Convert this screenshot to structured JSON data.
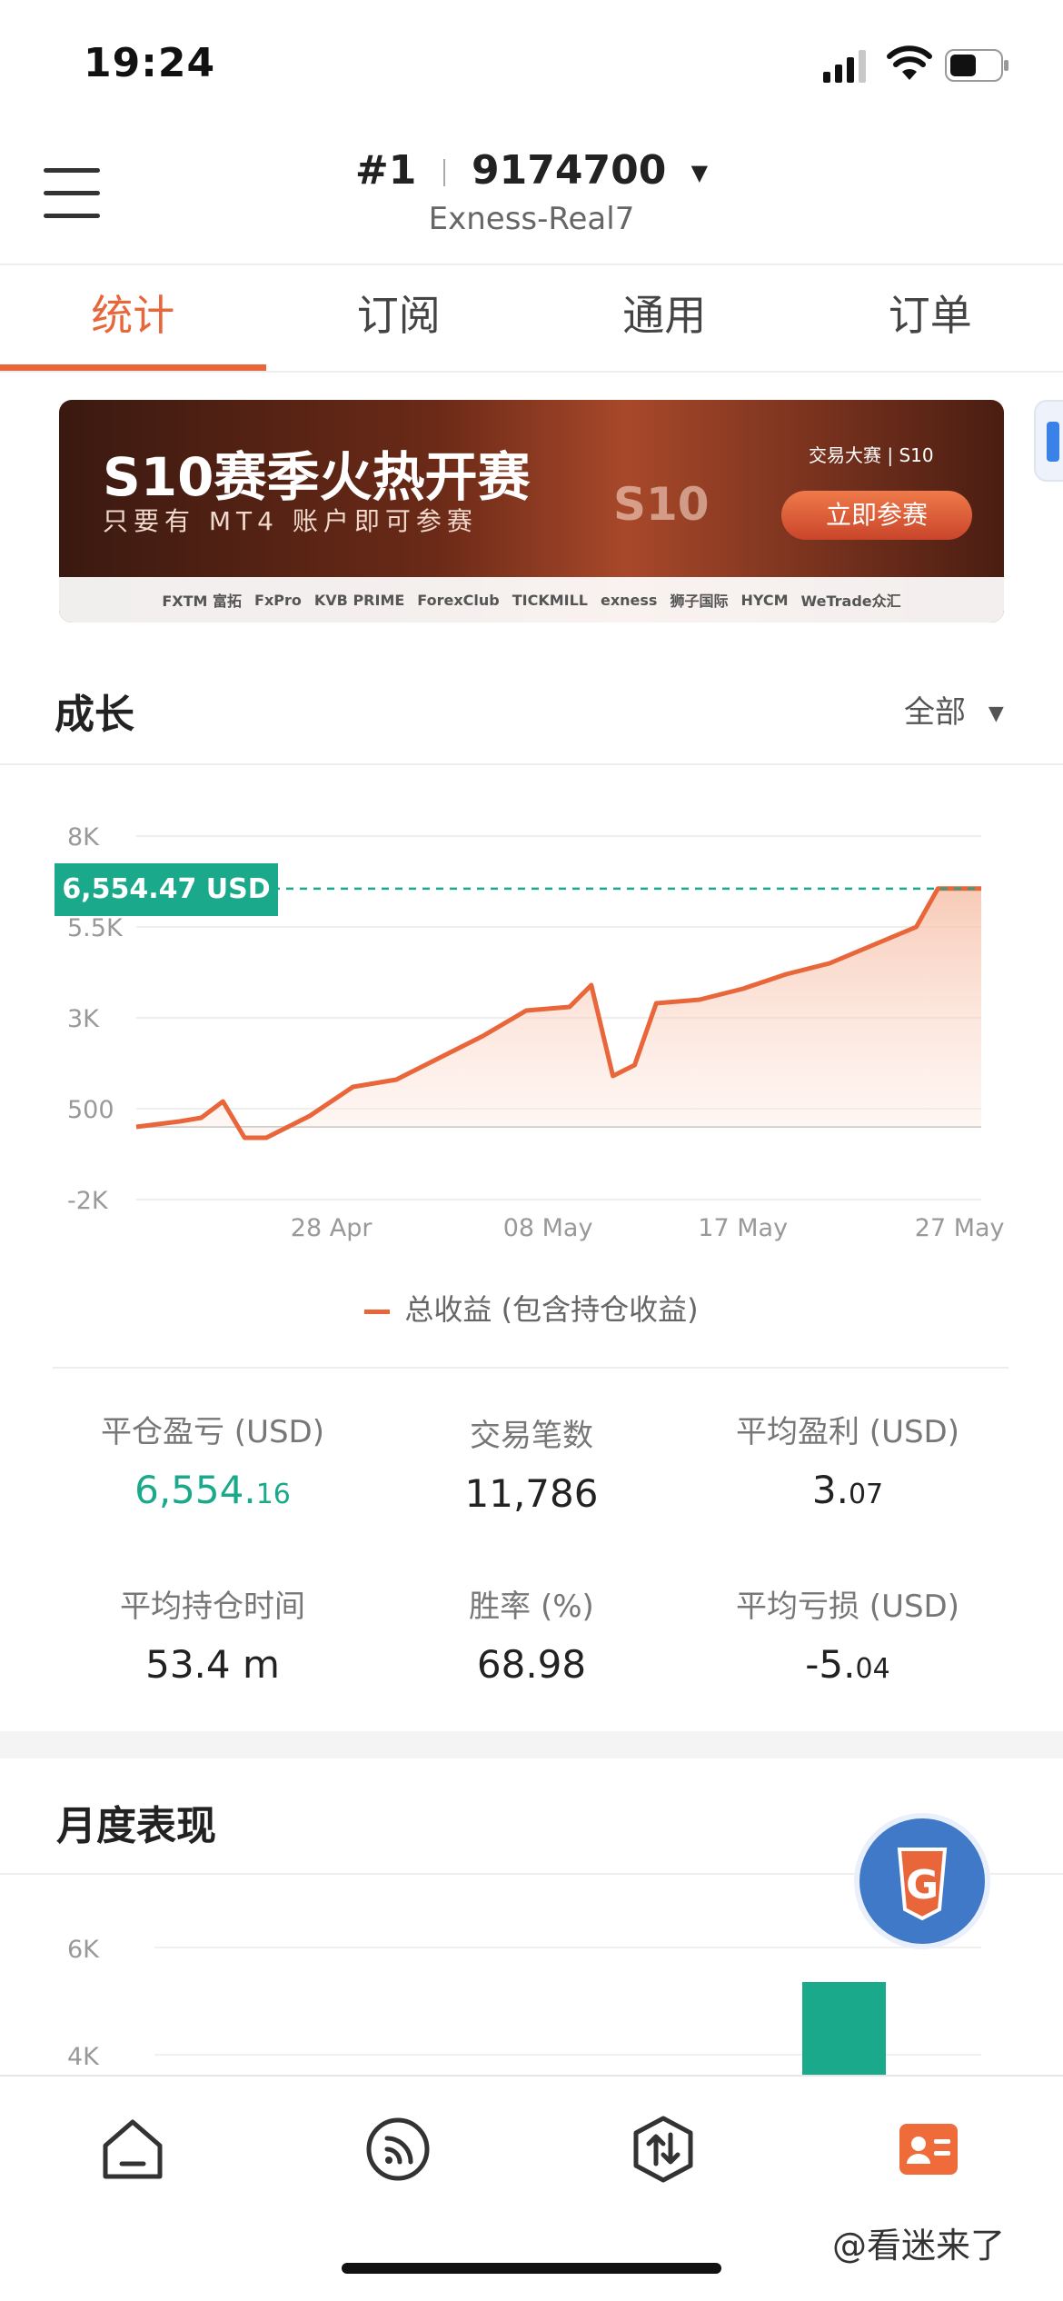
{
  "status_bar": {
    "time": "19:24"
  },
  "account": {
    "rank": "#1",
    "number": "9174700",
    "server": "Exness-Real7"
  },
  "tabs": [
    "统计",
    "订阅",
    "通用",
    "订单"
  ],
  "banner": {
    "title": "S10赛季火热开赛",
    "subtitle": "只要有 MT4 账户即可参赛",
    "center_mark": "S10",
    "brand": "交易大赛 | S10",
    "cta": "立即参赛",
    "sponsors": [
      "FXTM 富拓",
      "FxPro",
      "KVB PRIME",
      "ForexClub",
      "TICKMILL",
      "exness",
      "狮子国际",
      "HYCM",
      "WeTrade众汇"
    ]
  },
  "growth": {
    "title": "成长",
    "filter": "全部",
    "badge": "6,554.47 USD",
    "legend": "总收益 (包含持仓收益)"
  },
  "chart_data": {
    "type": "area",
    "title": "",
    "y_ticks": [
      "8K",
      "5.5K",
      "3K",
      "500",
      "-2K"
    ],
    "x_ticks": [
      "28 Apr",
      "08 May",
      "17 May",
      "27 May"
    ],
    "ylim": [
      -2000,
      8000
    ],
    "series": [
      {
        "name": "总收益 (包含持仓收益)",
        "x": [
          "19 Apr",
          "21 Apr",
          "22 Apr",
          "23 Apr",
          "24 Apr",
          "25 Apr",
          "27 Apr",
          "29 Apr",
          "01 May",
          "03 May",
          "05 May",
          "07 May",
          "09 May",
          "10 May",
          "11 May",
          "12 May",
          "13 May",
          "15 May",
          "17 May",
          "19 May",
          "21 May",
          "23 May",
          "25 May",
          "26 May",
          "28 May"
        ],
        "values": [
          0,
          150,
          250,
          700,
          -300,
          -300,
          300,
          1100,
          1300,
          1900,
          2500,
          3200,
          3300,
          3900,
          1400,
          1700,
          3400,
          3500,
          3800,
          4200,
          4500,
          5000,
          5500,
          6554.47,
          6554.47
        ]
      }
    ],
    "reference_line": 6554.47,
    "grid": true
  },
  "stats": [
    {
      "label": "平仓盈亏 (USD)",
      "value_main": "6,554.",
      "value_decimal": "16"
    },
    {
      "label": "交易笔数",
      "value_main": "11,786",
      "value_decimal": ""
    },
    {
      "label": "平均盈利 (USD)",
      "value_main": "3.",
      "value_decimal": "07"
    },
    {
      "label": "平均持仓时间",
      "value_main": "53.4 m",
      "value_decimal": ""
    },
    {
      "label": "胜率 (%)",
      "value_main": "68.98",
      "value_decimal": ""
    },
    {
      "label": "平均亏损 (USD)",
      "value_main": "-5.",
      "value_decimal": "04"
    }
  ],
  "monthly": {
    "title": "月度表现",
    "y_ticks": [
      "6K",
      "4K"
    ]
  },
  "watermark": "@看迷来了",
  "colors": {
    "accent": "#e8663a",
    "positive": "#1aa98a"
  }
}
